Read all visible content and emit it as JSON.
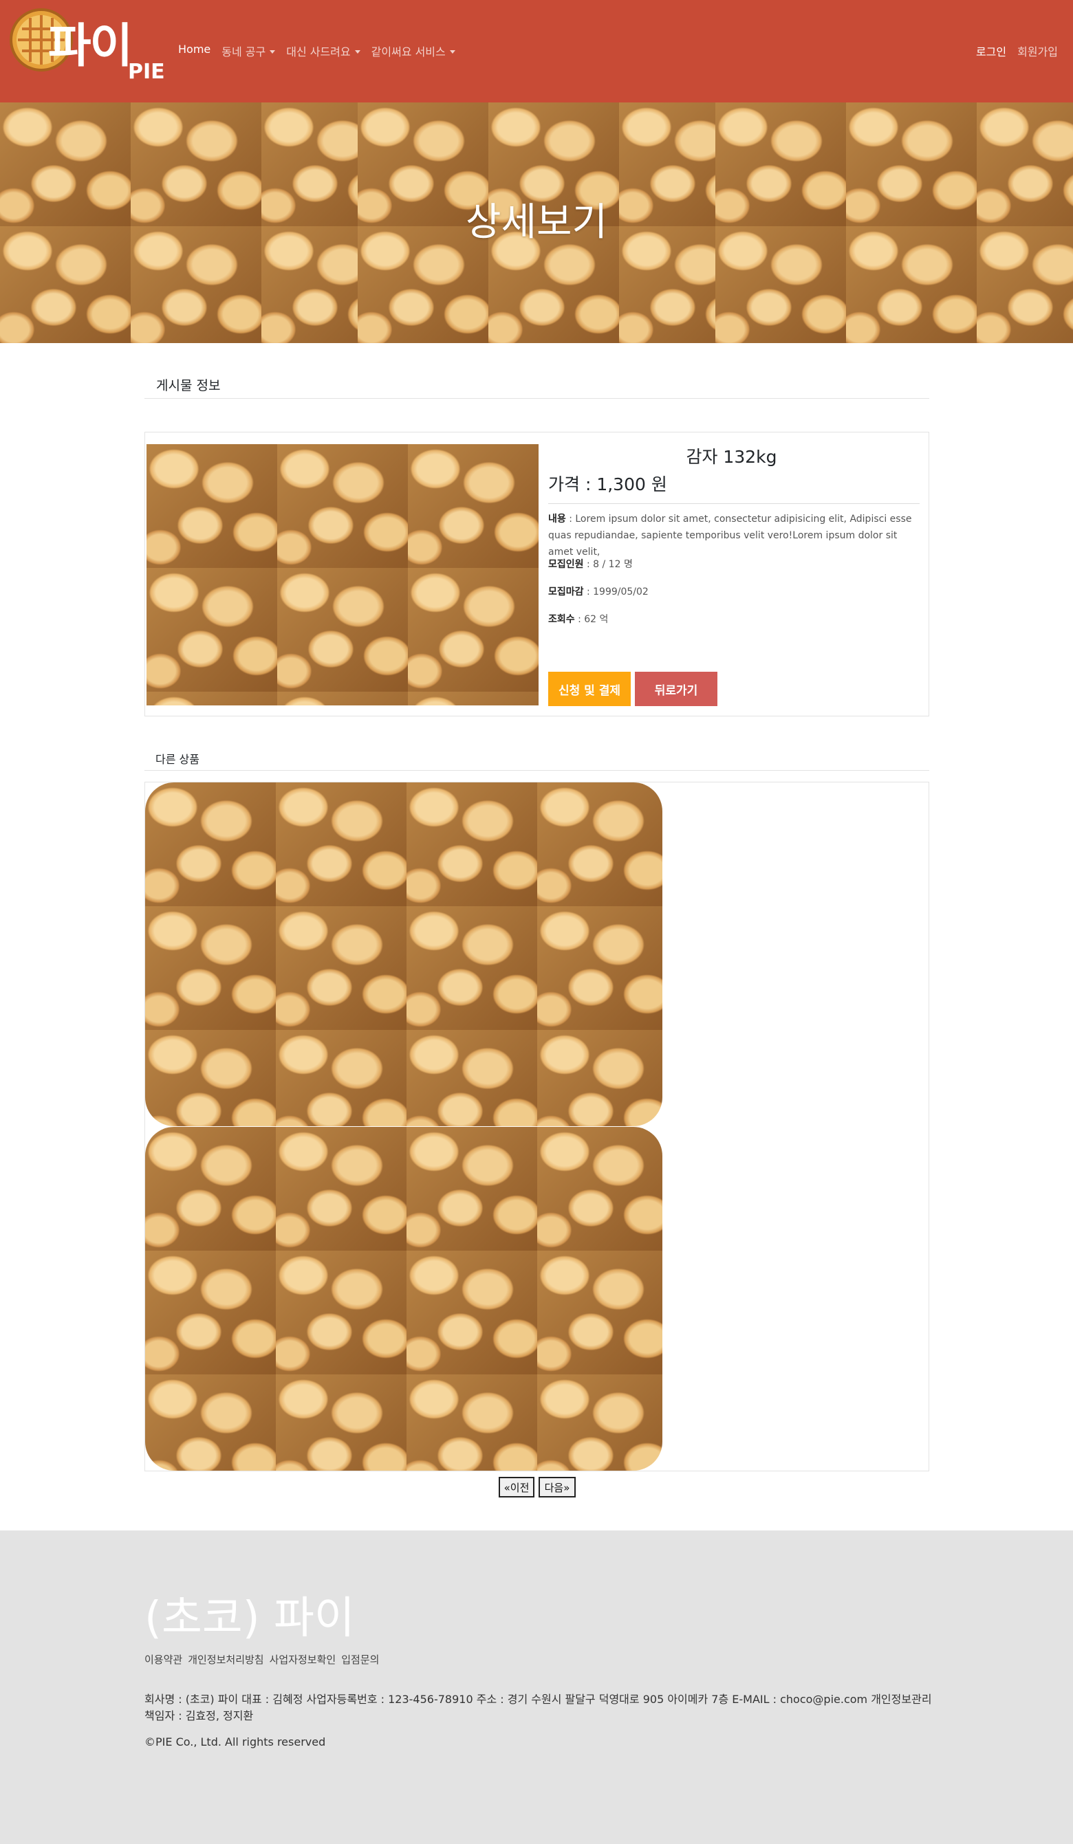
{
  "navbar": {
    "logo_text": "파이",
    "logo_sub": "PIE",
    "links": [
      "Home",
      "동네 공구",
      "대신 사드려요",
      "같이써요 서비스"
    ],
    "login": "로그인",
    "signup": "회원가입",
    "colors": {
      "navbar_bg": "#c84b36"
    }
  },
  "hero": {
    "title": "상세보기"
  },
  "post_section": {
    "title": "게시물 정보"
  },
  "product": {
    "name": "감자 132kg",
    "price": "가격 : 1,300 원",
    "content_label": "내용",
    "content": " : Lorem ipsum dolor sit amet, consectetur adipisicing elit, Adipisci esse quas repudiandae, sapiente temporibus velit vero!Lorem ipsum dolor sit amet velit,",
    "people_label": "모집인원",
    "people": " : 8 / 12 명",
    "deadline_label": "모집마감",
    "deadline": " : 1999/05/02",
    "views_label": "조회수",
    "views": " : 62 억",
    "apply_button": "신청 및 결제",
    "back_button": "뒤로가기",
    "colors": {
      "apply": "#fda70f",
      "back": "#d15b56"
    }
  },
  "others": {
    "title": "다른 상품"
  },
  "pagination": {
    "prev": "«이전",
    "next": "다음»"
  },
  "footer": {
    "brand": "(초코) 파이",
    "links": [
      "이용약관",
      "개인정보처리방침",
      "사업자정보확인",
      "입점문의"
    ],
    "info": "회사명 : (초코) 파이 대표 : 김혜정 사업자등록번호 : 123-456-78910 주소 : 경기 수원시 팔달구 덕영대로 905 아이메카 7층 E-MAIL : choco@pie.com 개인정보관리책임자 : 김효정, 정지환",
    "copyright": "©PIE Co., Ltd. All rights reserved"
  }
}
